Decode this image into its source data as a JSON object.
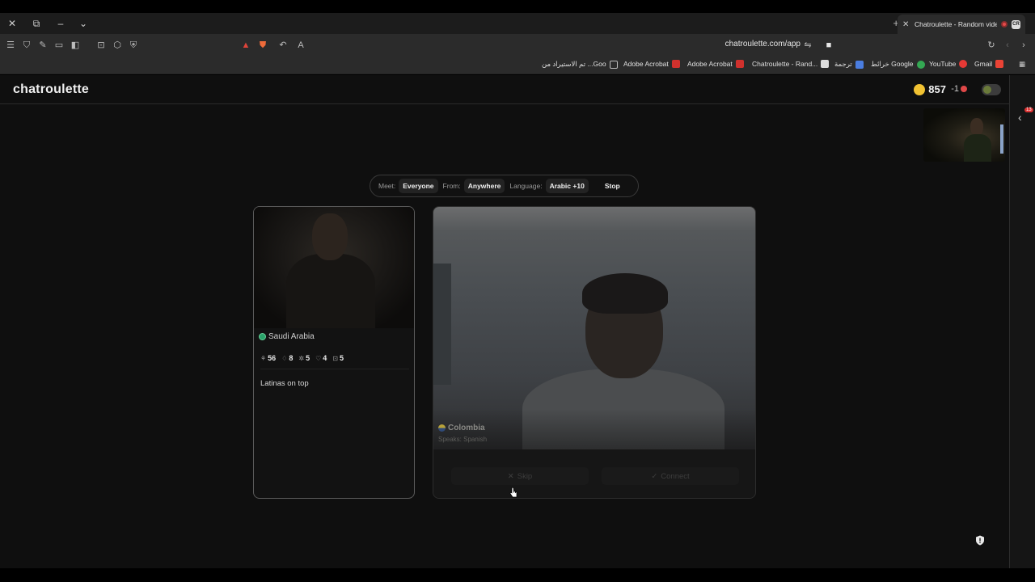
{
  "browser": {
    "tab_title": "Chatroulette - Random video",
    "tab_favicon": "CR",
    "url": "chatroulette.com/app",
    "bookmarks": [
      {
        "label": "تم الاستيراد من ...Goo",
        "color": "#444444"
      },
      {
        "label": "Adobe Acrobat",
        "color": "#d0312d"
      },
      {
        "label": "Adobe Acrobat",
        "color": "#d0312d"
      },
      {
        "label": "Chatroulette - Rand...",
        "color": "#dddddd"
      },
      {
        "label": "ترجمة",
        "color": "#4a7de0"
      },
      {
        "label": "خرائط Google",
        "color": "#34a853"
      },
      {
        "label": "YouTube",
        "color": "#e53935"
      },
      {
        "label": "Gmail",
        "color": "#ea4335"
      }
    ]
  },
  "header": {
    "logo": "chatroulette",
    "coins": "857",
    "minus": "-1"
  },
  "sidepanel": {
    "badge": "13"
  },
  "filter": {
    "meet_label": "Meet:",
    "meet_value": "Everyone",
    "from_label": "From:",
    "from_value": "Anywhere",
    "language_label": "Language:",
    "language_value": "Arabic +10",
    "stop_label": "Stop"
  },
  "profile_card": {
    "country": "Saudi Arabia",
    "stats": [
      {
        "icon": "users-icon",
        "glyph": "⚘",
        "value": "56"
      },
      {
        "icon": "gem-icon",
        "glyph": "♢",
        "value": "8"
      },
      {
        "icon": "star-icon",
        "glyph": "✲",
        "value": "5"
      },
      {
        "icon": "heart-icon",
        "glyph": "♡",
        "value": "4"
      },
      {
        "icon": "gift-icon",
        "glyph": "⊡",
        "value": "5"
      }
    ],
    "bio": "Latinas on top"
  },
  "video_card": {
    "country": "Colombia",
    "speaks": "Speaks: Spanish",
    "skip_label": "Skip",
    "connect_label": "Connect"
  }
}
